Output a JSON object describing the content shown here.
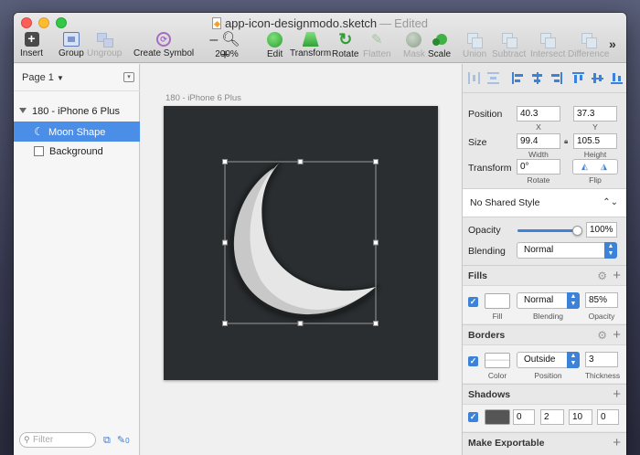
{
  "window": {
    "title": "app-icon-designmodo.sketch",
    "title_sep": "—",
    "status": "Edited"
  },
  "toolbar": {
    "insert": "Insert",
    "group": "Group",
    "ungroup": "Ungroup",
    "create_symbol": "Create Symbol",
    "zoom_minus": "–",
    "zoom_plus": "+",
    "zoom": "200%",
    "edit": "Edit",
    "transform": "Transform",
    "rotate": "Rotate",
    "flatten": "Flatten",
    "mask": "Mask",
    "scale": "Scale",
    "union": "Union",
    "subtract": "Subtract",
    "intersect": "Intersect",
    "difference": "Difference",
    "more": "»"
  },
  "sidebar": {
    "page": "Page 1",
    "artboard": "180 - iPhone 6 Plus",
    "layers": [
      "Moon Shape",
      "Background"
    ],
    "filter_placeholder": "Filter",
    "filter_count": "0"
  },
  "canvas": {
    "artboard_label": "180 - iPhone 6 Plus"
  },
  "inspector": {
    "position_label": "Position",
    "x": "40.3",
    "y": "37.3",
    "x_label": "X",
    "y_label": "Y",
    "size_label": "Size",
    "width": "99.4",
    "height": "105.5",
    "width_label": "Width",
    "height_label": "Height",
    "transform_label": "Transform",
    "rotate": "0°",
    "rotate_label": "Rotate",
    "flip_label": "Flip",
    "shared_style": "No Shared Style",
    "opacity_label": "Opacity",
    "opacity": "100%",
    "opacity_value": 1.0,
    "blending_label": "Blending",
    "blending": "Normal",
    "fills_title": "Fills",
    "fill_label": "Fill",
    "fill_blend": "Normal",
    "fill_blend_label": "Blending",
    "fill_opacity": "85%",
    "fill_opacity_label": "Opacity",
    "borders_title": "Borders",
    "border_color_label": "Color",
    "border_position": "Outside",
    "border_position_label": "Position",
    "border_thickness": "3",
    "border_thickness_label": "Thickness",
    "shadows_title": "Shadows",
    "shadow_x": "0",
    "shadow_y": "2",
    "shadow_blur": "10",
    "shadow_spread": "0",
    "exportable_title": "Make Exportable"
  },
  "colors": {
    "accent": "#3c82d8",
    "selection": "#4b8ee7",
    "artboard_bg": "#2b2e31",
    "moon": "#e6e6e6"
  }
}
